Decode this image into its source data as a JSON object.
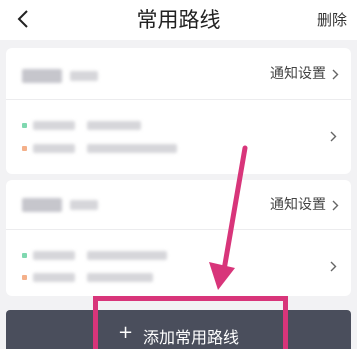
{
  "header": {
    "title": "常用路线",
    "delete_label": "删除"
  },
  "routes": [
    {
      "notify_label": "通知设置"
    },
    {
      "notify_label": "通知设置"
    }
  ],
  "footer": {
    "add_label": "添加常用路线"
  },
  "colors": {
    "annotation": "#d8357a",
    "add_bar": "#4a4e5c"
  }
}
